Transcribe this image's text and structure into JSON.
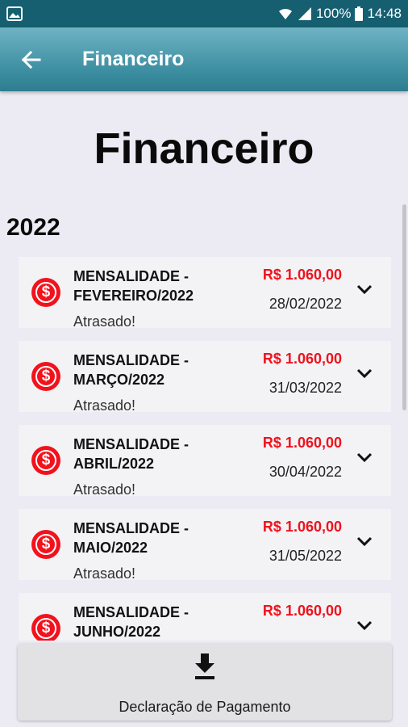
{
  "status_bar": {
    "battery": "100%",
    "time": "14:48"
  },
  "app_bar": {
    "title": "Financeiro"
  },
  "page": {
    "heading": "Financeiro",
    "year": "2022"
  },
  "payments": [
    {
      "title": "MENSALIDADE - FEVEREIRO/2022",
      "amount": "R$ 1.060,00",
      "due_date": "28/02/2022",
      "status": "Atrasado!"
    },
    {
      "title": "MENSALIDADE - MARÇO/2022",
      "amount": "R$ 1.060,00",
      "due_date": "31/03/2022",
      "status": "Atrasado!"
    },
    {
      "title": "MENSALIDADE - ABRIL/2022",
      "amount": "R$ 1.060,00",
      "due_date": "30/04/2022",
      "status": "Atrasado!"
    },
    {
      "title": "MENSALIDADE - MAIO/2022",
      "amount": "R$ 1.060,00",
      "due_date": "31/05/2022",
      "status": "Atrasado!"
    },
    {
      "title": "MENSALIDADE - JUNHO/2022",
      "amount": "R$ 1.060,00",
      "due_date": "",
      "status": ""
    }
  ],
  "actions": {
    "download_label": "Declaração de Pagamento"
  },
  "colors": {
    "primary": "#3b8da0",
    "status_bar": "#155f70",
    "overdue": "#f2121c"
  },
  "icons": {
    "coin": "dollar-coin-icon",
    "back": "arrow-left-icon",
    "expand": "chevron-down-icon",
    "download": "download-icon"
  }
}
